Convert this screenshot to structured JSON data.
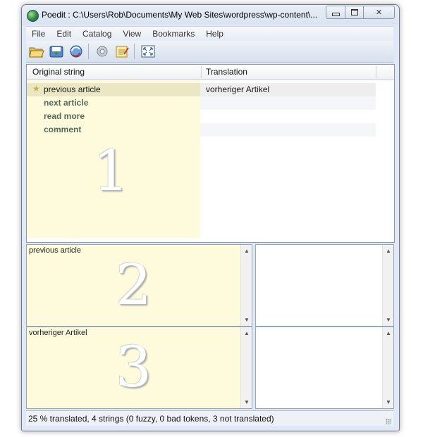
{
  "window": {
    "title": "Poedit : C:\\Users\\Rob\\Documents\\My Web Sites\\wordpress\\wp-content\\...",
    "app_icon": "globe-icon"
  },
  "menu": [
    "File",
    "Edit",
    "Catalog",
    "View",
    "Bookmarks",
    "Help"
  ],
  "toolbar": {
    "icons": [
      "open-folder-icon",
      "save-icon",
      "update-catalog-icon",
      "validate-icon",
      "comment-icon",
      "fullscreen-icon"
    ]
  },
  "list": {
    "headers": {
      "original": "Original string",
      "translation": "Translation"
    },
    "rows": [
      {
        "original": "previous article",
        "translation": "vorheriger Artikel",
        "selected": true,
        "starred": true
      },
      {
        "original": "next article",
        "translation": "",
        "untranslated": true
      },
      {
        "original": "read more",
        "translation": "",
        "untranslated": true
      },
      {
        "original": "comment",
        "translation": "",
        "untranslated": true
      }
    ],
    "label": "1"
  },
  "source_box": {
    "text": "previous article",
    "label": "2"
  },
  "translation_box": {
    "text": "vorheriger Artikel",
    "label": "3"
  },
  "status": {
    "text": "25 % translated, 4 strings (0 fuzzy, 0 bad tokens, 3 not translated)"
  },
  "colors": {
    "highlight": "#fdfbdc",
    "selected_row": "#ebe7c4",
    "untranslated_text": "#556a5a"
  }
}
